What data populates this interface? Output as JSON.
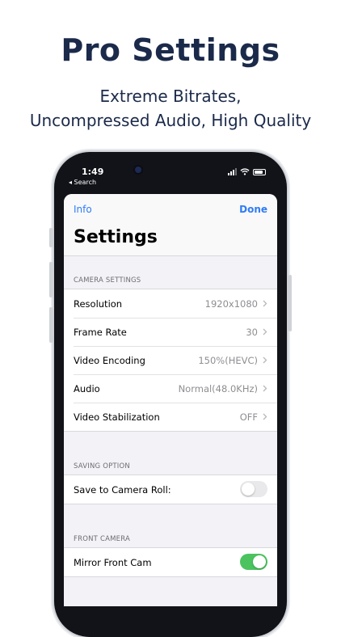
{
  "promo": {
    "title": "Pro Settings",
    "subtitle_line1": "Extreme Bitrates,",
    "subtitle_line2": "Uncompressed Audio, High Quality"
  },
  "status_bar": {
    "time": "1:49",
    "back_label": "◂ Search"
  },
  "nav": {
    "left_label": "Info",
    "right_label": "Done",
    "title": "Settings"
  },
  "camera_settings": {
    "header": "CAMERA SETTINGS",
    "rows": [
      {
        "label": "Resolution",
        "value": "1920x1080"
      },
      {
        "label": "Frame Rate",
        "value": "30"
      },
      {
        "label": "Video Encoding",
        "value": "150%(HEVC)"
      },
      {
        "label": "Audio",
        "value": "Normal(48.0KHz)"
      },
      {
        "label": "Video Stabilization",
        "value": "OFF"
      }
    ]
  },
  "saving_option": {
    "header": "SAVING OPTION",
    "row": {
      "label": "Save to Camera Roll:",
      "enabled": false
    }
  },
  "front_camera": {
    "header": "FRONT CAMERA",
    "row": {
      "label": "Mirror Front Cam",
      "enabled": true
    }
  },
  "colors": {
    "accent": "#2f7cf6",
    "toggle_on": "#4bc35f",
    "headline": "#1b2a4a"
  }
}
